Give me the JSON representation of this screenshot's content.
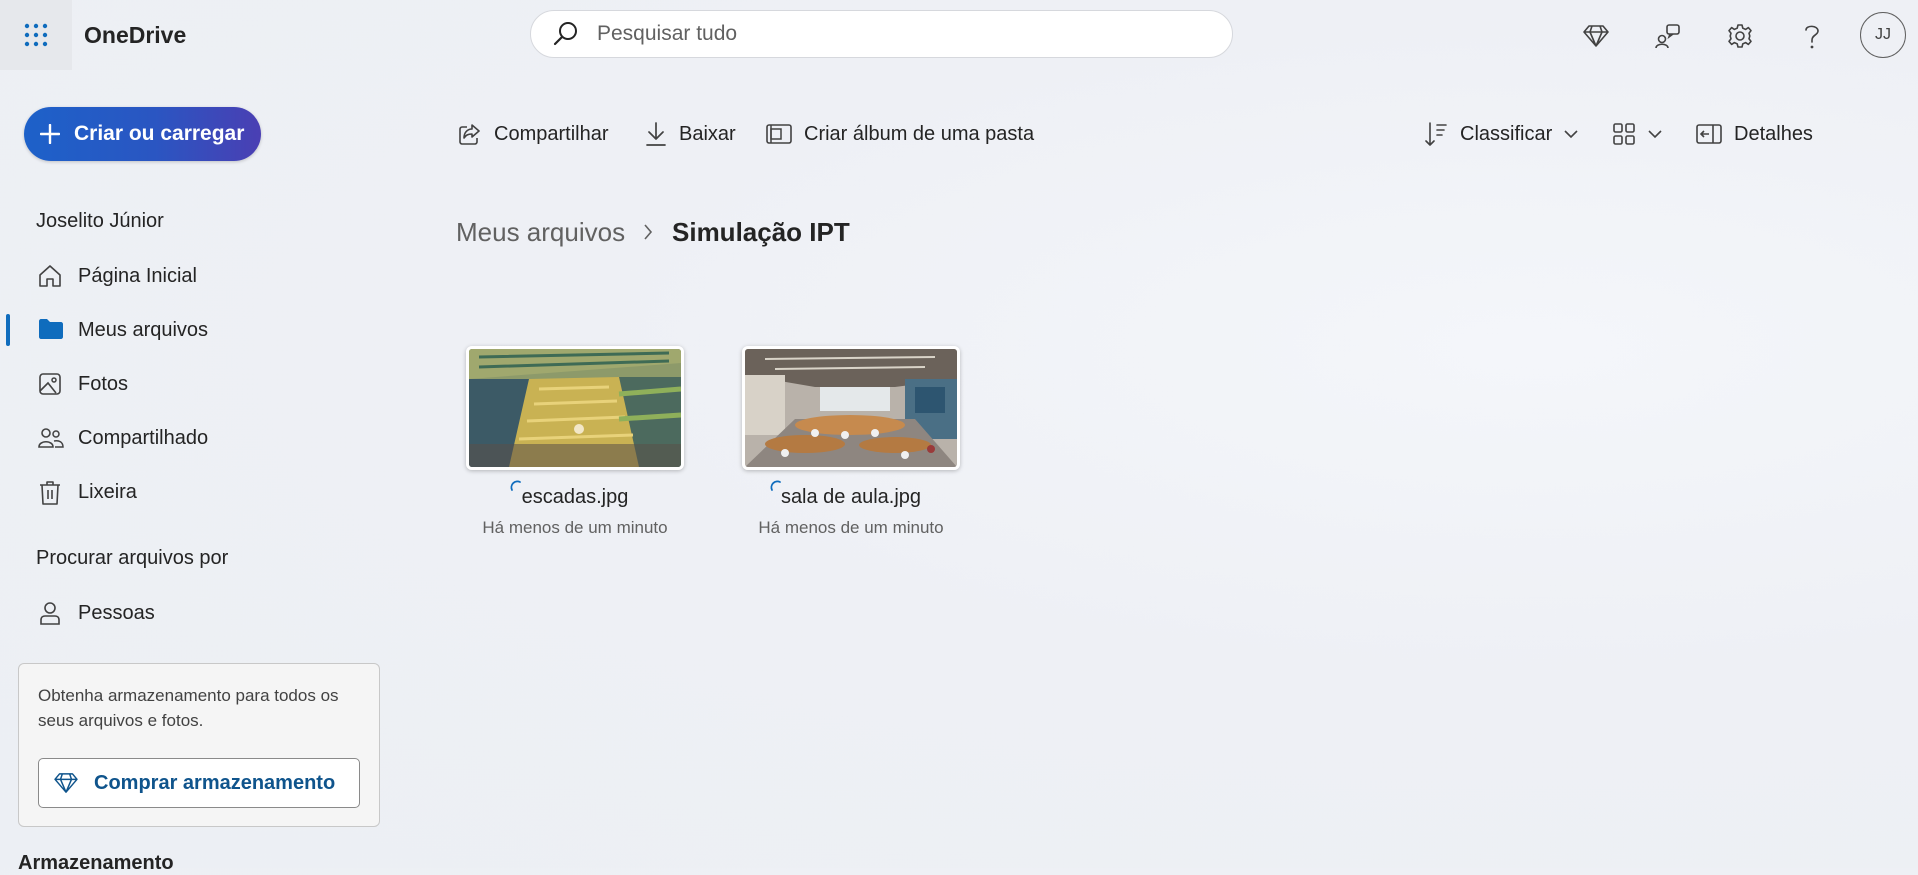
{
  "header": {
    "app_title": "OneDrive",
    "search_placeholder": "Pesquisar tudo",
    "avatar_initials": "JJ",
    "icons": [
      "waffle-icon",
      "premium-diamond-icon",
      "feedback-icon",
      "settings-icon",
      "help-icon"
    ]
  },
  "sidebar": {
    "create_label": "Criar ou carregar",
    "user_name": "Joselito Júnior",
    "items": [
      {
        "label": "Página Inicial",
        "icon": "home-icon"
      },
      {
        "label": "Meus arquivos",
        "icon": "folder-icon",
        "active": true
      },
      {
        "label": "Fotos",
        "icon": "photos-icon"
      },
      {
        "label": "Compartilhado",
        "icon": "shared-icon"
      },
      {
        "label": "Lixeira",
        "icon": "trash-icon"
      }
    ],
    "browse_label": "Procurar arquivos por",
    "people_label": "Pessoas",
    "storage_text": "Obtenha armazenamento para todos os seus arquivos e fotos.",
    "buy_label": "Comprar armazenamento",
    "storage_heading": "Armazenamento"
  },
  "commands": {
    "share": "Compartilhar",
    "download": "Baixar",
    "album": "Criar álbum de uma pasta",
    "sort": "Classificar",
    "details": "Detalhes"
  },
  "breadcrumb": {
    "parent": "Meus arquivos",
    "current": "Simulação IPT"
  },
  "files": [
    {
      "name": "escadas.jpg",
      "modified": "Há menos de um minuto"
    },
    {
      "name": "sala de aula.jpg",
      "modified": "Há menos de um minuto"
    }
  ],
  "colors": {
    "accent": "#0f6cbd",
    "create_gradient_start": "#1d61c9",
    "create_gradient_end": "#4a3fb3"
  }
}
